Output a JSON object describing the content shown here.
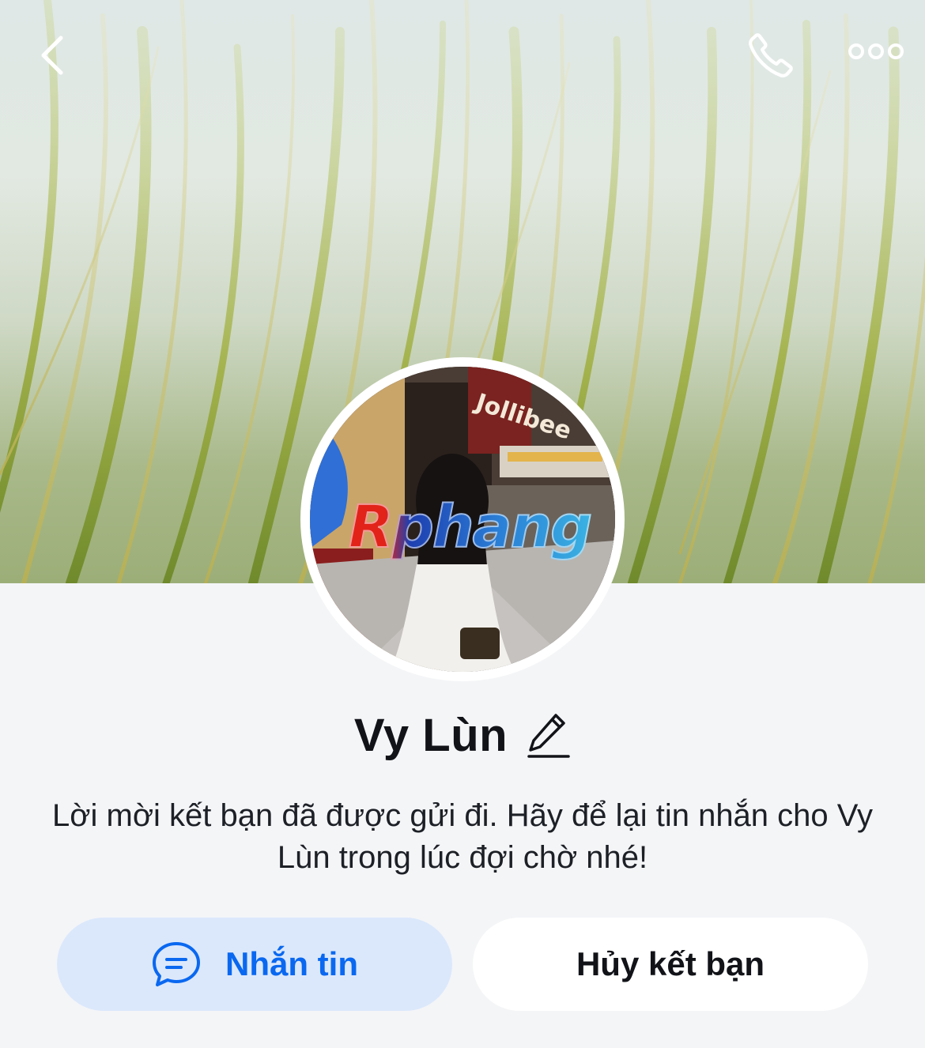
{
  "header": {
    "back_icon": "chevron-left-icon",
    "call_icon": "phone-icon",
    "more_icon": "more-horizontal-icon"
  },
  "profile": {
    "name": "Vy Lùn",
    "edit_icon": "pencil-icon",
    "avatar_watermark": "Rphang",
    "avatar_sign": "Jollibee"
  },
  "message": {
    "text": "Lời mời kết bạn đã được gửi đi. Hãy để lại tin nhắn cho Vy Lùn trong lúc đợi chờ nhé!"
  },
  "actions": {
    "message_label": "Nhắn tin",
    "message_icon": "chat-bubble-icon",
    "unfriend_label": "Hủy kết bạn"
  },
  "colors": {
    "accent": "#0a68f0",
    "accent_bg": "#dbe8fc",
    "page_bg": "#f4f5f7",
    "text": "#111318"
  }
}
